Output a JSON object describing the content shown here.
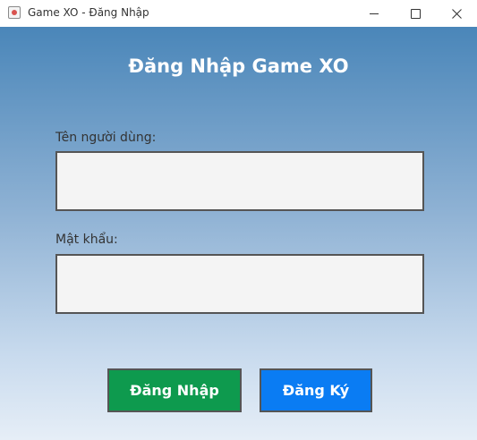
{
  "window": {
    "title": "Game XO - Đăng Nhập"
  },
  "form": {
    "heading": "Đăng Nhập Game XO",
    "username_label": "Tên người dùng:",
    "username_value": "",
    "password_label": "Mật khẩu:",
    "password_value": ""
  },
  "buttons": {
    "login_label": "Đăng Nhập",
    "register_label": "Đăng Ký"
  },
  "colors": {
    "login_button": "#0e9a4e",
    "register_button": "#0a7cf3",
    "gradient_top": "#4a86b9",
    "gradient_bottom": "#e6eef7"
  },
  "icons": {
    "app": "java-app-icon",
    "minimize": "minimize-icon",
    "maximize": "maximize-icon",
    "close": "close-icon"
  }
}
